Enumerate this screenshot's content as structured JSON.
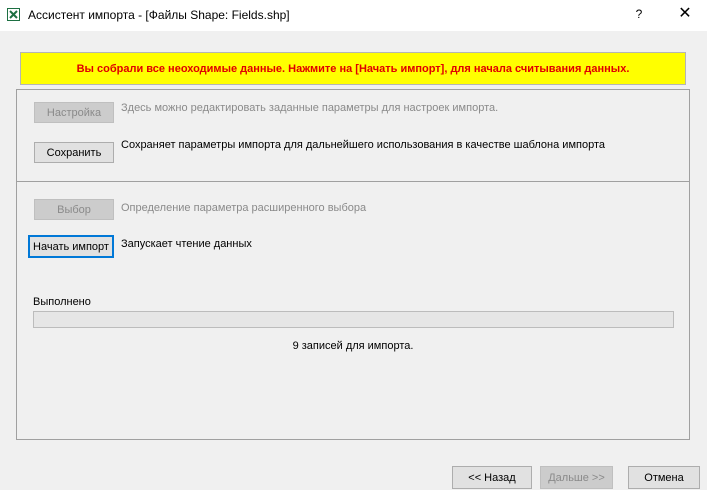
{
  "window": {
    "title": "Ассистент импорта - [Файлы Shape: Fields.shp]",
    "help_label": "?",
    "close_label": "✕",
    "icon": "excel-import-icon"
  },
  "banner": {
    "text": "Вы собрали все неоходимые данные. Нажмите на [Начать импорт], для начала считывания данных.",
    "text_color": "#e00000",
    "background": "#ffff00"
  },
  "settings": {
    "button": "Настройка",
    "description": "Здесь можно редактировать заданные параметры для настроек импорта."
  },
  "save": {
    "button": "Сохранить",
    "description": "Сохраняет параметры импорта для дальнейшего использования в качестве шаблона импорта"
  },
  "select": {
    "button": "Выбор",
    "description": "Определение параметра расширенного выбора"
  },
  "start": {
    "button": "Начать импорт",
    "description": "Запускает чтение данных"
  },
  "progress": {
    "label": "Выполнено",
    "value": 0
  },
  "records_text": "9 записей для импорта.",
  "footer": {
    "back": "<< Назад",
    "next": "Дальше >>",
    "cancel": "Отмена"
  }
}
